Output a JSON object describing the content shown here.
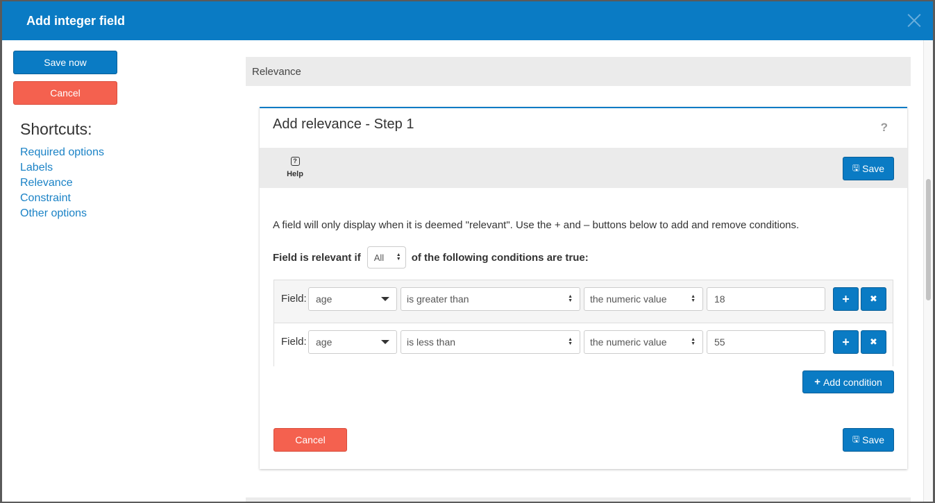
{
  "modal": {
    "title": "Add integer field"
  },
  "sidebar": {
    "save_now_label": "Save now",
    "cancel_label": "Cancel",
    "shortcuts_title": "Shortcuts:",
    "links": [
      "Required options",
      "Labels",
      "Relevance",
      "Constraint",
      "Other options"
    ]
  },
  "section": {
    "title": "Relevance"
  },
  "panel": {
    "title": "Add relevance - Step 1",
    "help_symbol": "?",
    "toolbar": {
      "help_label": "Help",
      "save_label": "Save"
    },
    "description": "A field will only display when it is deemed \"relevant\". Use the + and – buttons below to add and remove conditions.",
    "rule_prefix": "Field is relevant if",
    "rule_select_value": "All",
    "rule_suffix": "of the following conditions are true:",
    "field_label": "Field:",
    "conditions": [
      {
        "field": "age",
        "operator": "is greater than",
        "value_type": "the numeric value",
        "value": "18"
      },
      {
        "field": "age",
        "operator": "is less than",
        "value_type": "the numeric value",
        "value": "55"
      }
    ],
    "add_condition_label": "Add condition",
    "cancel_label": "Cancel",
    "save_label": "Save"
  },
  "icons": {
    "close": "close-icon",
    "help": "help-icon",
    "save": "floppy-disk-icon",
    "plus": "plus-icon",
    "remove": "remove-icon",
    "dropdown": "chevron-down-icon"
  },
  "colors": {
    "primary": "#0a7bc4",
    "danger": "#f4614f",
    "link": "#1a82c6"
  }
}
